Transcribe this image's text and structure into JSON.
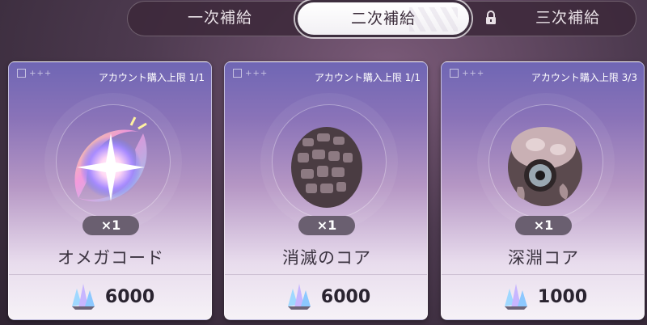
{
  "tabs": [
    {
      "label": "一次補給",
      "active": false,
      "locked": false
    },
    {
      "label": "二次補給",
      "active": true,
      "locked": false
    },
    {
      "label": "三次補給",
      "active": false,
      "locked": true
    }
  ],
  "icons": {
    "lock": "lock-icon",
    "currency": "crystal-gem-icon"
  },
  "cards": [
    {
      "limit": "アカウント購入上限 1/1",
      "quantity": "×1",
      "name": "オメガコード",
      "price": "6000",
      "item_icon": "omega-code-icon"
    },
    {
      "limit": "アカウント購入上限 1/1",
      "quantity": "×1",
      "name": "消滅のコア",
      "price": "6000",
      "item_icon": "annihilation-core-icon"
    },
    {
      "limit": "アカウント購入上限 3/3",
      "quantity": "×1",
      "name": "深淵コア",
      "price": "1000",
      "item_icon": "abyss-core-icon"
    }
  ],
  "colors": {
    "card_top": "#6f66b4",
    "card_bottom": "#f6f2f7",
    "qty_badge": "#6a5f70"
  }
}
